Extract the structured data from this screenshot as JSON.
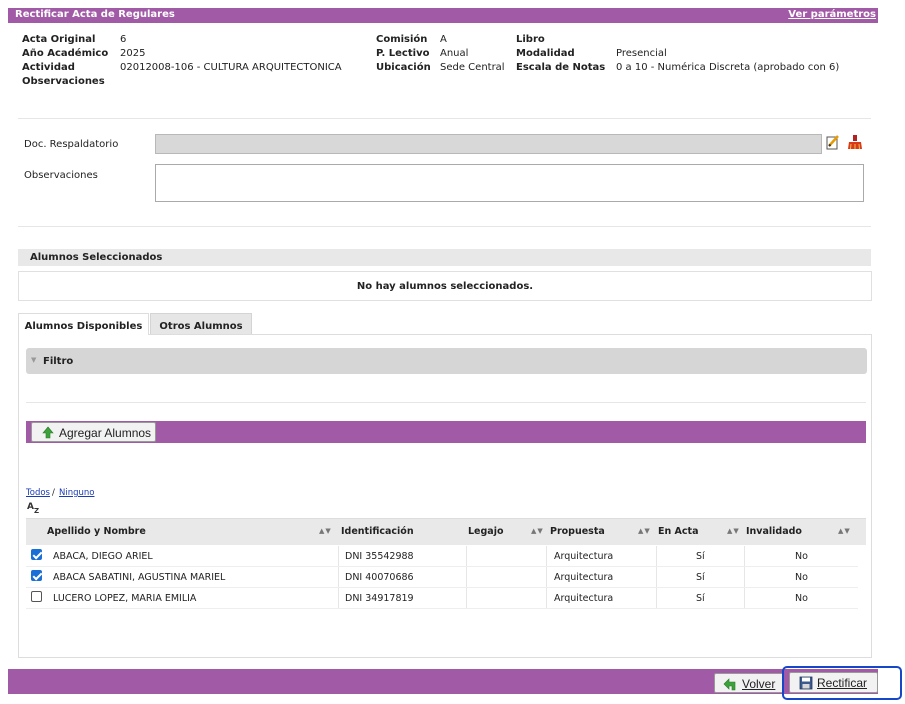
{
  "header": {
    "title": "Rectificar Acta de Regulares",
    "params_link": "Ver parámetros"
  },
  "info": {
    "acta_original_label": "Acta Original",
    "acta_original": "6",
    "anio_label": "Año Académico",
    "anio": "2025",
    "actividad_label": "Actividad",
    "actividad": "02012008-106 - CULTURA ARQUITECTONICA",
    "observaciones_label": "Observaciones",
    "comision_label": "Comisión",
    "comision": "A",
    "lectivo_label": "P. Lectivo",
    "lectivo": "Anual",
    "ubicacion_label": "Ubicación",
    "ubicacion": "Sede Central",
    "libro_label": "Libro",
    "libro": "",
    "modalidad_label": "Modalidad",
    "modalidad": "Presencial",
    "escala_label": "Escala de Notas",
    "escala": "0 a 10 - Numérica Discreta (aprobado con 6)"
  },
  "form": {
    "doc_label": "Doc. Respaldatorio",
    "doc_value": "",
    "obs_label": "Observaciones",
    "obs_value": ""
  },
  "selected": {
    "title": "Alumnos Seleccionados",
    "empty": "No hay alumnos seleccionados."
  },
  "tabs": {
    "active": "Alumnos Disponibles",
    "other": "Otros Alumnos"
  },
  "filter": {
    "label": "Filtro"
  },
  "add_button": "Agregar Alumnos",
  "links": {
    "todos": "Todos",
    "sep": "/",
    "ninguno": "Ninguno"
  },
  "table": {
    "headers": [
      "Apellido y Nombre",
      "Identificación",
      "Legajo",
      "Propuesta",
      "En Acta",
      "Invalidado"
    ],
    "rows": [
      {
        "checked": true,
        "nombre": "ABACA, DIEGO ARIEL",
        "id": "DNI 35542988",
        "legajo": "",
        "propuesta": "Arquitectura",
        "en_acta": "Sí",
        "invalidado": "No"
      },
      {
        "checked": true,
        "nombre": "ABACA SABATINI, AGUSTINA MARIEL",
        "id": "DNI 40070686",
        "legajo": "",
        "propuesta": "Arquitectura",
        "en_acta": "Sí",
        "invalidado": "No"
      },
      {
        "checked": false,
        "nombre": "LUCERO LOPEZ, MARIA EMILIA",
        "id": "DNI 34917819",
        "legajo": "",
        "propuesta": "Arquitectura",
        "en_acta": "Sí",
        "invalidado": "No"
      }
    ]
  },
  "footer": {
    "volver": "Volver",
    "rectificar": "Rectificar"
  },
  "colors": {
    "accent": "#a15ba6",
    "highlight": "#1747c9",
    "checkbox": "#1a6fd6"
  }
}
